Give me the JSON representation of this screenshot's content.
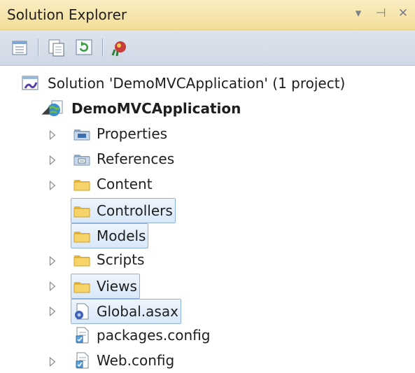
{
  "panel": {
    "title": "Solution Explorer",
    "pin_glyph": "⊣",
    "dropdown_glyph": "▾",
    "close_glyph": "✕"
  },
  "toolbar": {
    "buttons": [
      {
        "name": "properties-window-icon"
      },
      {
        "name": "show-all-files-icon"
      },
      {
        "name": "refresh-icon"
      },
      {
        "name": "view-class-diagram-icon"
      }
    ]
  },
  "tree": {
    "solution": "Solution 'DemoMVCApplication' (1 project)",
    "project": "DemoMVCApplication",
    "items": [
      {
        "label": "Properties",
        "icon": "properties-icon",
        "expander": "collapsed"
      },
      {
        "label": "References",
        "icon": "references-icon",
        "expander": "collapsed"
      },
      {
        "label": "Content",
        "icon": "folder-icon",
        "expander": "collapsed"
      },
      {
        "label": "Controllers",
        "icon": "folder-icon",
        "expander": "none",
        "selected": true
      },
      {
        "label": "Models",
        "icon": "folder-icon",
        "expander": "none",
        "selected": true
      },
      {
        "label": "Scripts",
        "icon": "folder-icon",
        "expander": "collapsed"
      },
      {
        "label": "Views",
        "icon": "folder-icon",
        "expander": "collapsed",
        "selected": true
      },
      {
        "label": "Global.asax",
        "icon": "asax-file-icon",
        "expander": "collapsed",
        "selected": true
      },
      {
        "label": "packages.config",
        "icon": "config-file-icon",
        "expander": "none"
      },
      {
        "label": "Web.config",
        "icon": "config-file-icon",
        "expander": "collapsed"
      }
    ]
  },
  "colors": {
    "title_bar": "#f3dd9a",
    "toolbar": "#d5dde9",
    "selection_border": "#8fb2d8",
    "folder": "#f2c94c"
  }
}
